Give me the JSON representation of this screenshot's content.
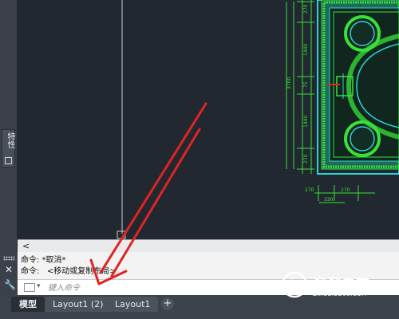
{
  "colors": {
    "canvas_bg": "#212830",
    "cad_green": "#39e03a",
    "cad_cyan": "#2fd3cf",
    "annotation_red": "#e02424"
  },
  "sidebar": {
    "properties_label": "特性",
    "properties_icon": "palette-icon"
  },
  "canvas": {
    "dimensions_left": [
      "270",
      "1440",
      "75",
      "1440",
      "270",
      "3700"
    ],
    "dimensions_bottom": [
      "270",
      "270",
      "320"
    ]
  },
  "command": {
    "history": [
      "命令: *取消*",
      "命令:   <移动或复制布局>"
    ],
    "input_placeholder": "键入命令",
    "input_value": ""
  },
  "tabs": [
    {
      "label": "模型",
      "active": true
    },
    {
      "label": "Layout1 (2)",
      "active": false
    },
    {
      "label": "Layout1",
      "active": false
    }
  ],
  "tab_add_label": "+",
  "watermark": {
    "title": "溜溜自学",
    "url": "ZIXUE.3D66.COM"
  }
}
